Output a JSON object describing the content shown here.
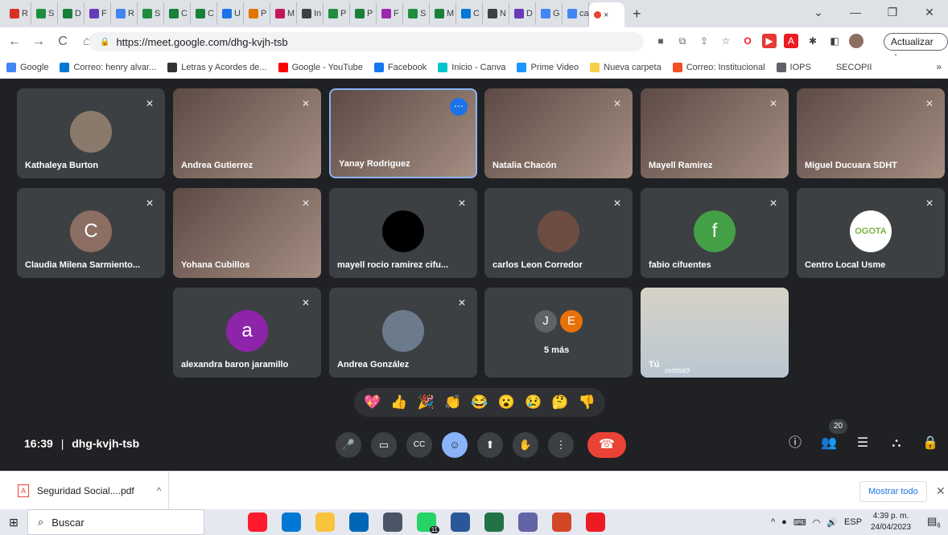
{
  "browser": {
    "tabs": [
      {
        "label": "R",
        "color": "#d93025"
      },
      {
        "label": "S",
        "color": "#1e8e3e"
      },
      {
        "label": "D",
        "color": "#188038"
      },
      {
        "label": "F",
        "color": "#673ab7"
      },
      {
        "label": "R",
        "color": "#4285f4"
      },
      {
        "label": "S",
        "color": "#1e8e3e"
      },
      {
        "label": "C",
        "color": "#188038"
      },
      {
        "label": "C",
        "color": "#188038"
      },
      {
        "label": "U",
        "color": "#1a73e8"
      },
      {
        "label": "P",
        "color": "#e37400"
      },
      {
        "label": "M",
        "color": "#c2185b"
      },
      {
        "label": "In",
        "color": "#3c4043"
      },
      {
        "label": "P",
        "color": "#1e8e3e"
      },
      {
        "label": "P",
        "color": "#188038"
      },
      {
        "label": "F",
        "color": "#9c27b0"
      },
      {
        "label": "S",
        "color": "#1e8e3e"
      },
      {
        "label": "M",
        "color": "#188038"
      },
      {
        "label": "C",
        "color": "#0078d4"
      },
      {
        "label": "N",
        "color": "#3c4043"
      },
      {
        "label": "D",
        "color": "#673ab7"
      },
      {
        "label": "G",
        "color": "#4285f4"
      },
      {
        "label": "ca",
        "color": "#4285f4"
      }
    ],
    "active_tab_close": "×",
    "new_tab": "+",
    "window_controls": {
      "collapse": "⌄",
      "minimize": "—",
      "maximize": "❐",
      "close": "✕"
    },
    "nav": {
      "back": "←",
      "forward": "→",
      "reload": "C",
      "home": "⌂"
    },
    "url": "https://meet.google.com/dhg-kvjh-tsb",
    "update_label": "Actualizar",
    "bookmarks": [
      {
        "label": "Google",
        "color": "#4285f4"
      },
      {
        "label": "Correo: henry alvar...",
        "color": "#0078d4"
      },
      {
        "label": "Letras y Acordes de...",
        "color": "#333333"
      },
      {
        "label": "Google - YouTube",
        "color": "#ff0000"
      },
      {
        "label": "Facebook",
        "color": "#1877f2"
      },
      {
        "label": "Inicio - Canva",
        "color": "#00c4cc"
      },
      {
        "label": "Prime Video",
        "color": "#1a98ff"
      },
      {
        "label": "Nueva carpeta",
        "color": "#f9ce4a"
      },
      {
        "label": "Correo: Institucional",
        "color": "#f25022"
      },
      {
        "label": "IOPS",
        "color": "#5f6368"
      },
      {
        "label": "SECOPII",
        "color": "#ffffff"
      }
    ],
    "bookmarks_more": "»"
  },
  "meet": {
    "participants": [
      {
        "name": "Kathaleya Burton",
        "initial": "",
        "color": "#8a7a6c"
      },
      {
        "name": "Andrea Gutierrez",
        "initial": "",
        "color": ""
      },
      {
        "name": "Yanay Rodriguez",
        "initial": "",
        "color": ""
      },
      {
        "name": "Natalia Chacón",
        "initial": "",
        "color": ""
      },
      {
        "name": "Mayell Ramirez",
        "initial": "",
        "color": ""
      },
      {
        "name": "Miguel Ducuara SDHT",
        "initial": "",
        "color": ""
      },
      {
        "name": "Claudia Milena Sarmiento...",
        "initial": "C",
        "color": "#8d6e63"
      },
      {
        "name": "Yohana Cubillos",
        "initial": "",
        "color": ""
      },
      {
        "name": "mayell rocio ramirez cifu...",
        "initial": "",
        "color": "#000000"
      },
      {
        "name": "carlos Leon Corredor",
        "initial": "",
        "color": "#6d4c41"
      },
      {
        "name": "fabio cifuentes",
        "initial": "f",
        "color": "#43a047"
      },
      {
        "name": "Centro Local Usme",
        "initial": "OGOTA",
        "color": "#ffffff"
      },
      {
        "name": "alexandra baron jaramillo",
        "initial": "a",
        "color": "#8e24aa"
      },
      {
        "name": "Andrea González",
        "initial": "",
        "color": "#6b7b8c"
      },
      {
        "name": "5 más",
        "initial": "",
        "color": ""
      },
      {
        "name": "Tú",
        "initial": "",
        "color": ""
      }
    ],
    "more_initials": [
      "J",
      "E"
    ],
    "more_colors": [
      "#5f6368",
      "#e8710a"
    ],
    "self_caption": "ovidsa9",
    "reactions": [
      "💖",
      "👍",
      "🎉",
      "👏",
      "😂",
      "😮",
      "😢",
      "🤔",
      "👎"
    ],
    "time": "16:39",
    "separator": "|",
    "meeting_code": "dhg-kvjh-tsb",
    "controls": {
      "mic": "🎤",
      "camera": "▭",
      "captions": "CC",
      "emoji": "☺",
      "present": "⬆",
      "raise_hand": "✋",
      "more": "⋮",
      "end": "☎"
    },
    "right_controls": {
      "info": "ⓘ",
      "people": "👥",
      "chat": "☰",
      "activities": "⛬",
      "lock": "🔒"
    },
    "people_count": "20"
  },
  "downloads": {
    "file": "Seguridad Social....pdf",
    "show_all": "Mostrar todo",
    "close": "✕",
    "expand": "^"
  },
  "taskbar": {
    "search": "Buscar",
    "tray_lang": "ESP",
    "time": "4:39 p. m.",
    "date": "24/04/2023",
    "apps": [
      {
        "name": "opera",
        "color": "#ff1b2d"
      },
      {
        "name": "edge",
        "color": "#0078d4"
      },
      {
        "name": "explorer",
        "color": "#f9c33e"
      },
      {
        "name": "store",
        "color": "#0067b8"
      },
      {
        "name": "browser",
        "color": "#4a5568"
      },
      {
        "name": "whatsapp",
        "color": "#25d366"
      },
      {
        "name": "word",
        "color": "#2b579a"
      },
      {
        "name": "excel",
        "color": "#217346"
      },
      {
        "name": "teams",
        "color": "#6264a7"
      },
      {
        "name": "powerpoint",
        "color": "#d24726"
      },
      {
        "name": "acrobat",
        "color": "#ec1c24"
      }
    ],
    "whatsapp_badge": "11",
    "notif_badge": "6"
  }
}
